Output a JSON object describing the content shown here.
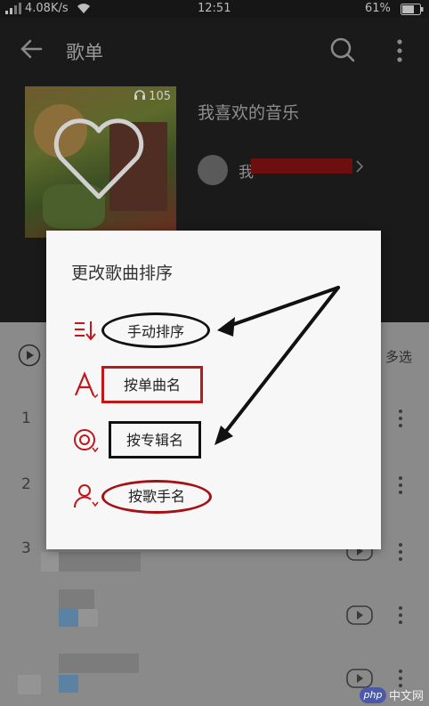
{
  "status_bar": {
    "speed": "4.08K/s",
    "time": "12:51",
    "battery": "61%"
  },
  "app_bar": {
    "title": "歌单"
  },
  "playlist": {
    "play_count": "105",
    "name": "我喜欢的音乐",
    "owner_visible": "我"
  },
  "list": {
    "multiselect_label": "多选",
    "row_indices": [
      "1",
      "2",
      "3"
    ]
  },
  "dialog": {
    "title": "更改歌曲排序",
    "options": [
      {
        "label": "手动排序",
        "icon": "manual-sort-icon"
      },
      {
        "label": "按单曲名",
        "icon": "letter-a-icon"
      },
      {
        "label": "按专辑名",
        "icon": "album-icon"
      },
      {
        "label": "按歌手名",
        "icon": "singer-icon"
      }
    ]
  },
  "watermark": {
    "logo": "php",
    "text": "中文网"
  },
  "colors": {
    "accent_red": "#c0171b",
    "annotation_black": "#111111"
  }
}
